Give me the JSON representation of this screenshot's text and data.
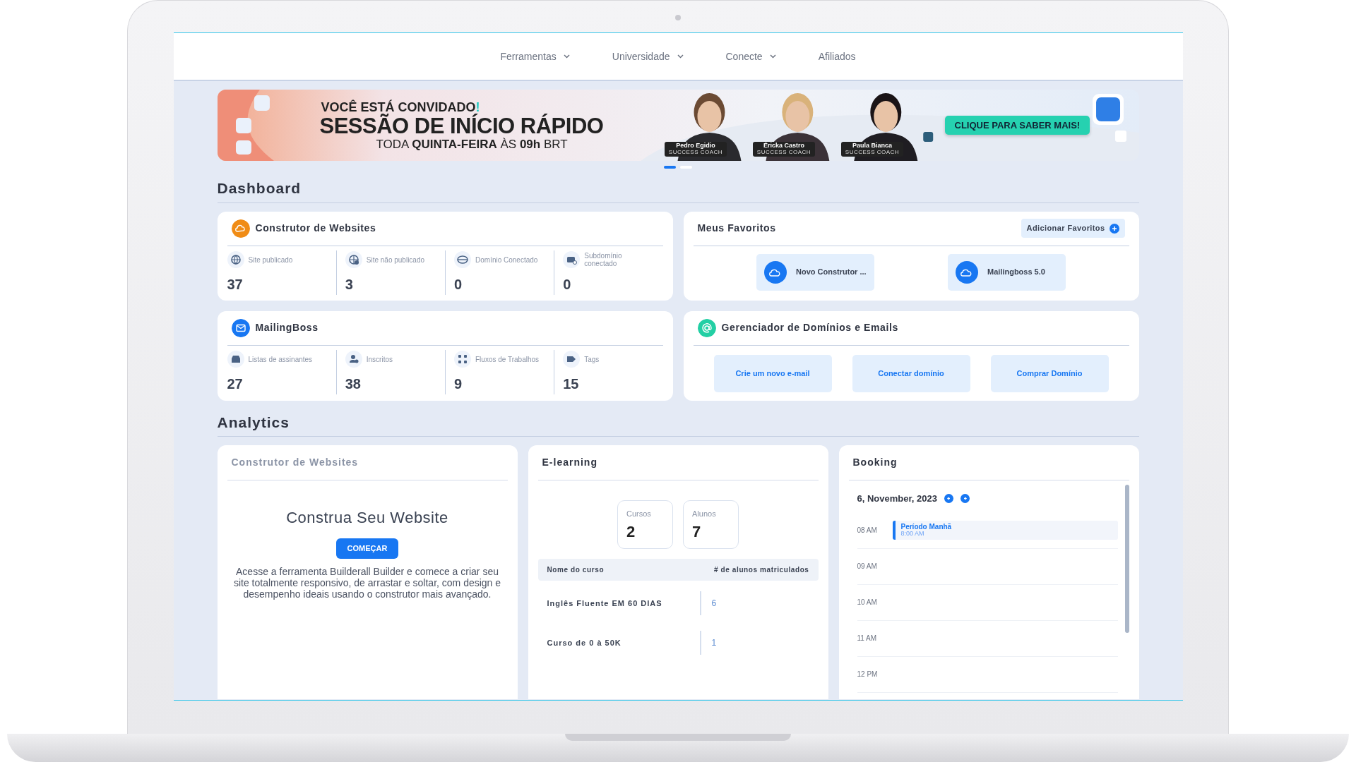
{
  "nav": [
    {
      "label": "Ferramentas",
      "dropdown": true
    },
    {
      "label": "Universidade",
      "dropdown": true
    },
    {
      "label": "Conecte",
      "dropdown": true
    },
    {
      "label": "Afiliados",
      "dropdown": false
    }
  ],
  "banner": {
    "headline": "VOCÊ ESTÁ CONVIDADO",
    "headline_accent": "!",
    "title": "SESSÃO DE INÍCIO RÁPIDO",
    "schedule": "TODA **QUINTA-FEIRA** ÀS **09h** BRT",
    "coaches": [
      {
        "name": "Pedro Egidio",
        "role": "SUCCESS COACH"
      },
      {
        "name": "Éricka Castro",
        "role": "SUCCESS COACH"
      },
      {
        "name": "Paula Bianca",
        "role": "SUCCESS COACH"
      }
    ],
    "cta": "CLIQUE PARA SABER MAIS!"
  },
  "carousel_dots": [
    {
      "selected": true
    },
    {
      "selected": false
    }
  ],
  "dashboard": {
    "title": "Dashboard",
    "website_builder": {
      "title": "Construtor de Websites",
      "stats": [
        {
          "label": "Site publicado",
          "value": "37"
        },
        {
          "label": "Site não publicado",
          "value": "3"
        },
        {
          "label": "Domínio Conectado",
          "value": "0"
        },
        {
          "label": "Subdomínio conectado",
          "value": "0"
        }
      ]
    },
    "favorites": {
      "title": "Meus Favoritos",
      "add_button": "Adicionar Favoritos",
      "items": [
        {
          "label": "Novo Construtor ..."
        },
        {
          "label": "Mailingboss 5.0"
        }
      ]
    },
    "mailingboss": {
      "title": "MailingBoss",
      "stats": [
        {
          "label": "Listas de assinantes",
          "value": "27"
        },
        {
          "label": "Inscritos",
          "value": "38"
        },
        {
          "label": "Fluxos de Trabalhos",
          "value": "9"
        },
        {
          "label": "Tags",
          "value": "15"
        }
      ]
    },
    "domains": {
      "title": "Gerenciador de Domínios e Emails",
      "buttons": [
        "Crie um novo e-mail",
        "Conectar domínio",
        "Comprar Domínio"
      ]
    }
  },
  "analytics": {
    "title": "Analytics",
    "builder": {
      "title": "Construtor de Websites",
      "heading": "Construa Seu Website",
      "button": "COMEÇAR",
      "description": "Acesse a ferramenta Builderall Builder e comece a criar seu site totalmente responsivo, de arrastar e soltar, com design e desempenho ideais usando o construtor mais avançado."
    },
    "elearning": {
      "title": "E-learning",
      "stats": [
        {
          "label": "Cursos",
          "value": "2"
        },
        {
          "label": "Alunos",
          "value": "7"
        }
      ],
      "columns": [
        "Nome do curso",
        "# de alunos matriculados"
      ],
      "rows": [
        {
          "name": "Inglês Fluente EM 60 DIAS",
          "count": "6"
        },
        {
          "name": "Curso de 0 à 50K",
          "count": "1"
        }
      ]
    },
    "booking": {
      "title": "Booking",
      "date": "6, November, 2023",
      "slots": [
        {
          "time": "08 AM",
          "event": {
            "title": "Período Manhã",
            "time": "8:00 AM"
          }
        },
        {
          "time": "09 AM"
        },
        {
          "time": "10 AM"
        },
        {
          "time": "11 AM"
        },
        {
          "time": "12 PM"
        }
      ]
    }
  }
}
